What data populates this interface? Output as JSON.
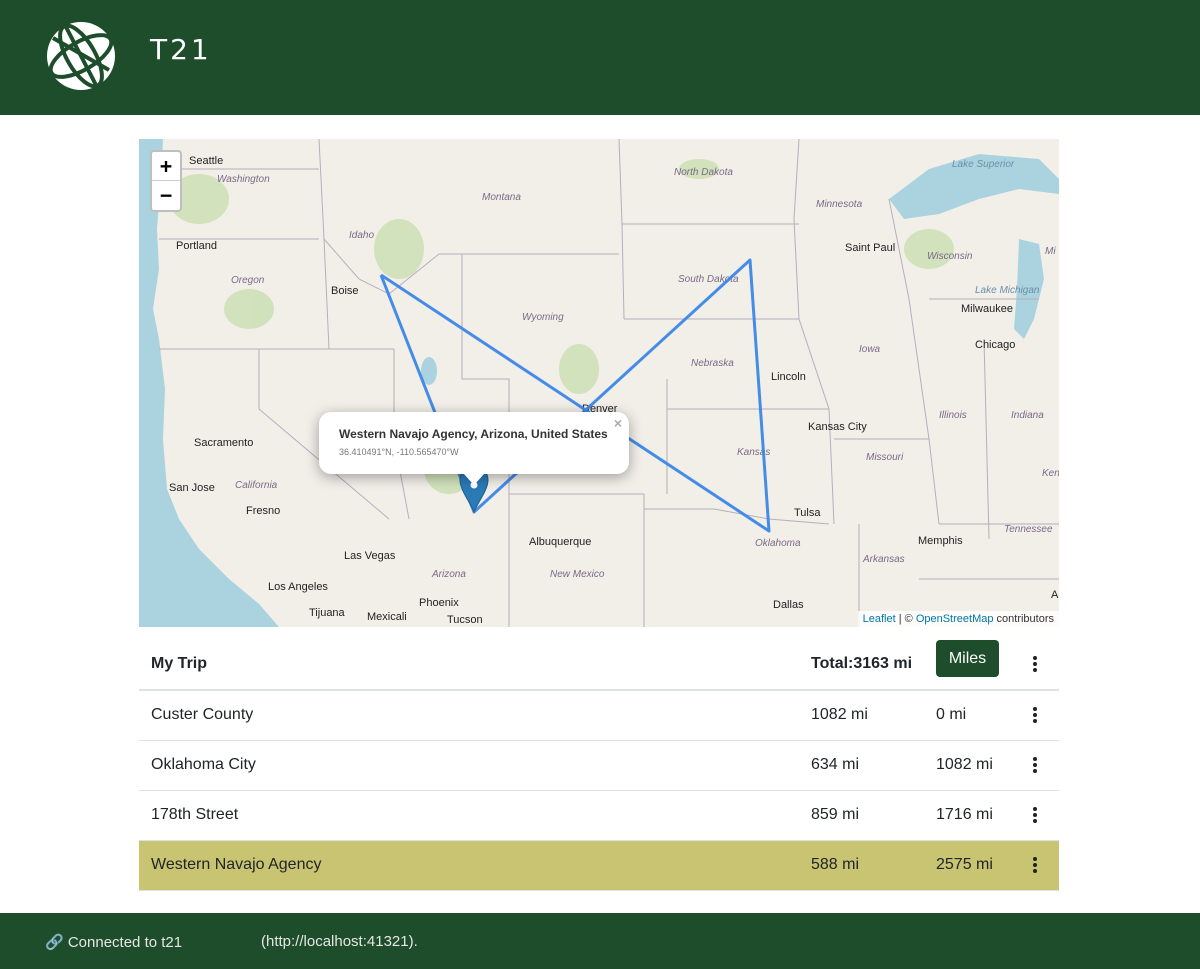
{
  "header": {
    "title": "T21",
    "logo_icon": "globe-icon"
  },
  "map": {
    "zoom_in": "+",
    "zoom_out": "−",
    "attribution": {
      "leaflet": "Leaflet",
      "separator": " | © ",
      "osm": "OpenStreetMap",
      "suffix": " contributors"
    },
    "popup": {
      "name": "Western Navajo Agency, Arizona, United States",
      "coords": "36.410491°N, -110.565470°W",
      "close": "×"
    },
    "labels": {
      "cities": [
        "Seattle",
        "Portland",
        "Boise",
        "Sacramento",
        "San Jose",
        "Fresno",
        "Los Angeles",
        "Tijuana",
        "Mexicali",
        "Las Vegas",
        "Phoenix",
        "Tucson",
        "Albuquerque",
        "Denver",
        "Lincoln",
        "Kansas City",
        "Tulsa",
        "Dallas",
        "Saint Paul",
        "Milwaukee",
        "Chicago",
        "Memphis"
      ],
      "states": [
        "Washington",
        "Oregon",
        "Idaho",
        "Montana",
        "Wyoming",
        "California",
        "Arizona",
        "New Mexico",
        "North Dakota",
        "South Dakota",
        "Nebraska",
        "Kansas",
        "Oklahoma",
        "Minnesota",
        "Iowa",
        "Missouri",
        "Arkansas",
        "Wisconsin",
        "Illinois",
        "Indiana",
        "Tennessee",
        "Lake Superior",
        "Lake Michigan",
        "Mi",
        "Ken",
        "A"
      ]
    },
    "route_color": "#3b86e8",
    "marker_color": "#2a7ab8"
  },
  "trip": {
    "title": "My Trip",
    "total": "Total:3163 mi",
    "units": "Miles",
    "places": [
      {
        "name": "Custer County",
        "leg": "1082 mi",
        "cumulative": "0 mi",
        "selected": false
      },
      {
        "name": "Oklahoma City",
        "leg": "634 mi",
        "cumulative": "1082 mi",
        "selected": false
      },
      {
        "name": "178th Street",
        "leg": "859 mi",
        "cumulative": "1716 mi",
        "selected": false
      },
      {
        "name": "Western Navajo Agency",
        "leg": "588 mi",
        "cumulative": "2575 mi",
        "selected": true
      }
    ],
    "selected_color": "#c8c472"
  },
  "footer": {
    "status": "🔗 Connected to t21",
    "url": "(http://localhost:41321)."
  },
  "colors": {
    "brand": "#1e4d2b"
  }
}
